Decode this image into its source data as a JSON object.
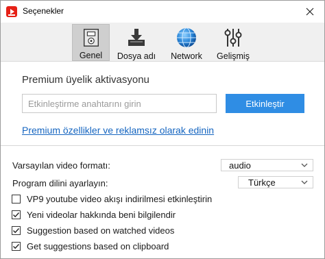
{
  "window": {
    "title": "Seçenekler"
  },
  "icons": {
    "app": "video-download-app-icon",
    "close": "close-icon"
  },
  "tabs": [
    {
      "label": "Genel",
      "icon": "general-settings-icon",
      "active": true
    },
    {
      "label": "Dosya adı",
      "icon": "file-download-icon",
      "active": false
    },
    {
      "label": "Network",
      "icon": "globe-icon",
      "active": false
    },
    {
      "label": "Gelişmiş",
      "icon": "sliders-icon",
      "active": false
    }
  ],
  "premium": {
    "title": "Premium üyelik aktivasyonu",
    "key_placeholder": "Etkinleştirme anahtarını girin",
    "key_value": "",
    "activate_label": "Etkinleştir",
    "link_text": "Premium özellikler ve reklamsız olarak edinin",
    "accent_color": "#2f8de4"
  },
  "settings": {
    "video_format": {
      "label": "Varsayılan video formatı:",
      "value": "audio"
    },
    "language": {
      "label": "Program dilini ayarlayın:",
      "value": "Türkçe"
    },
    "checkboxes": [
      {
        "label": "VP9 youtube video akışı indirilmesi etkinleştirin",
        "checked": false
      },
      {
        "label": "Yeni videolar hakkında beni bilgilendir",
        "checked": true
      },
      {
        "label": "Suggestion based on watched videos",
        "checked": true
      },
      {
        "label": "Get suggestions based on clipboard",
        "checked": true
      }
    ]
  }
}
